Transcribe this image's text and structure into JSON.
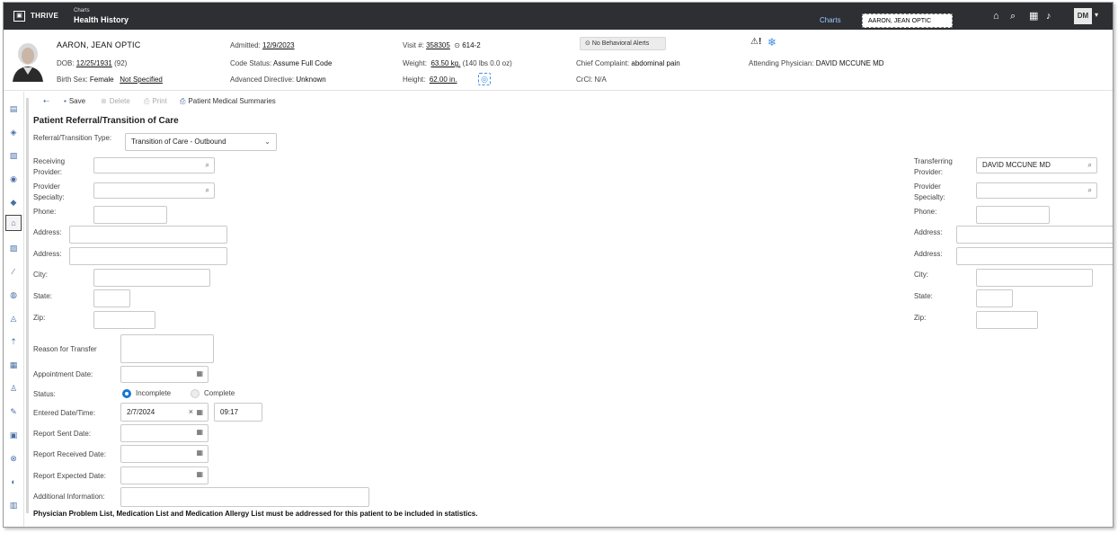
{
  "topbar": {
    "brand": "THRIVE",
    "breadcrumb_parent": "Charts",
    "breadcrumb_title": "Health History",
    "charts_link": "Charts",
    "patient_tab": "AARON, JEAN OPTIC",
    "user_initials": "DM",
    "icons": [
      "home-icon",
      "search-icon",
      "apps-grid-icon",
      "bell-icon"
    ]
  },
  "banner": {
    "patient_name": "AARON, JEAN OPTIC",
    "dob_label": "DOB:",
    "dob_value": "12/25/1931",
    "age": "(92)",
    "birth_sex_label": "Birth Sex:",
    "birth_sex_value": "Female",
    "gender_value": "Not Specified",
    "admitted_label": "Admitted:",
    "admitted_value": "12/9/2023",
    "code_status_label": "Code Status:",
    "code_status_value": "Assume Full Code",
    "adv_directive_label": "Advanced Directive:",
    "adv_directive_value": "Unknown",
    "visit_label": "Visit #:",
    "visit_value": "358305",
    "room_value": "614-2",
    "weight_label": "Weight:",
    "weight_value": "63.50 kg.",
    "weight_lbs": "(140 lbs 0.0 oz)",
    "height_label": "Height:",
    "height_value": "62.00 in.",
    "behavioral_alerts": "No Behavioral Alerts",
    "chief_complaint_label": "Chief Complaint:",
    "chief_complaint_value": "abdominal pain",
    "crcl_label": "CrCl:",
    "crcl_value": "N/A",
    "attending_label": "Attending Physician:",
    "attending_value": "DAVID MCCUNE MD"
  },
  "toolbar": {
    "save": "Save",
    "delete": "Delete",
    "print": "Print",
    "summaries": "Patient Medical Summaries"
  },
  "form": {
    "title": "Patient Referral/Transition of Care",
    "type_label": "Referral/Transition Type:",
    "type_value": "Transition of Care - Outbound",
    "receiving_provider_label": "Receiving Provider:",
    "provider_specialty_label": "Provider Specialty:",
    "phone_label": "Phone:",
    "address_label": "Address:",
    "city_label": "City:",
    "state_label": "State:",
    "zip_label": "Zip:",
    "transferring_provider_label": "Transferring Provider:",
    "transferring_provider_value": "DAVID MCCUNE MD",
    "reason_label": "Reason for Transfer",
    "appointment_label": "Appointment Date:",
    "status_label": "Status:",
    "status_incomplete": "Incomplete",
    "status_complete": "Complete",
    "entered_label": "Entered Date/Time:",
    "entered_date": "2/7/2024",
    "entered_time": "09:17",
    "report_sent_label": "Report Sent Date:",
    "report_received_label": "Report Received Date:",
    "report_expected_label": "Report Expected Date:",
    "additional_info_label": "Additional Information:",
    "footnote": "Physician Problem List, Medication List and Medication Allergy List must be addressed for this patient to be included in statistics."
  }
}
